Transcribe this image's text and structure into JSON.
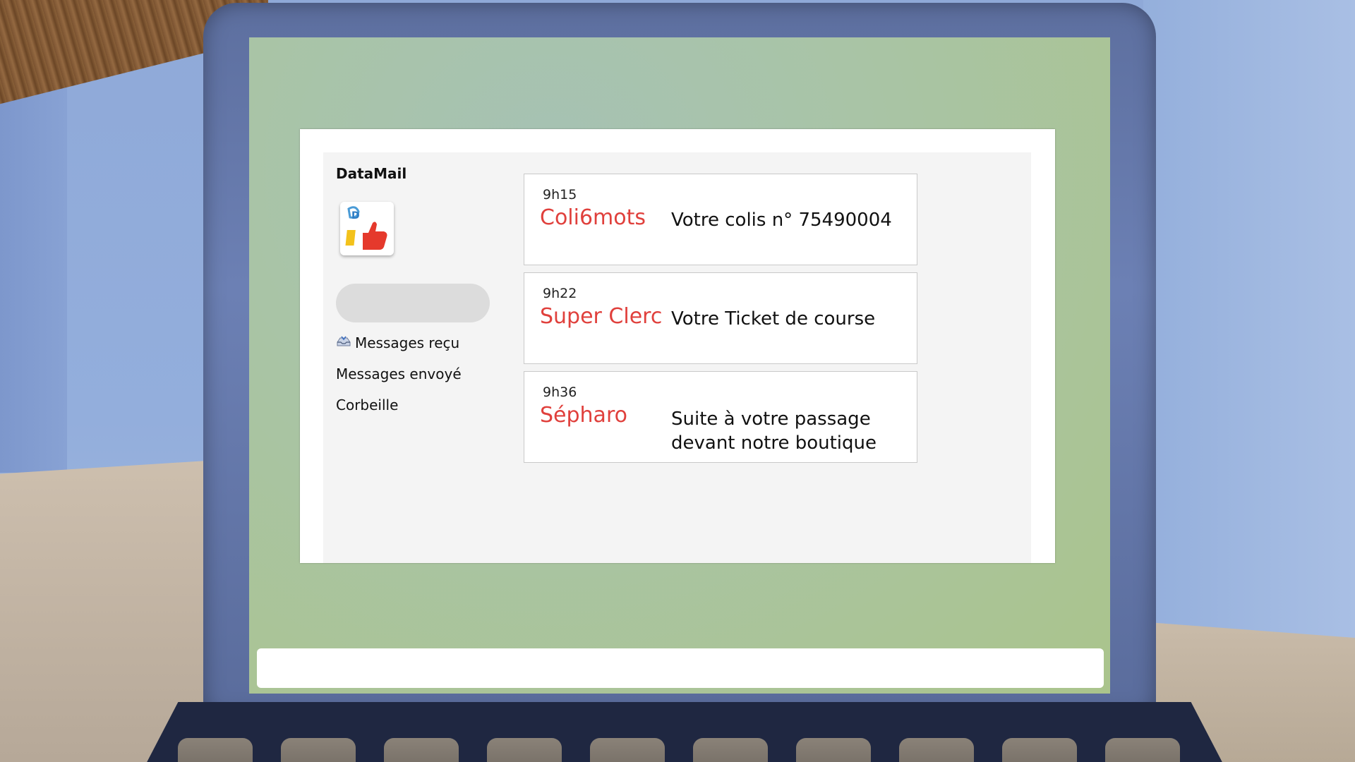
{
  "app": {
    "name": "DataMail",
    "logo_icon": "thumbs-up-logo-icon"
  },
  "sidebar": {
    "search_placeholder": "",
    "nav": [
      {
        "label": "Messages reçu",
        "icon": "inbox-tray-icon"
      },
      {
        "label": "Messages envoyé"
      },
      {
        "label": "Corbeille"
      }
    ]
  },
  "messages": [
    {
      "time": "9h15",
      "sender": "Coli6mots",
      "subject": "Votre colis n° 75490004"
    },
    {
      "time": "9h22",
      "sender": "Super Clerc",
      "subject": "Votre Ticket de course"
    },
    {
      "time": "9h36",
      "sender": "Sépharo",
      "subject": "Suite à votre passage devant notre boutique"
    }
  ],
  "colors": {
    "sender": "#e0403c",
    "app_background": "#f4f4f4",
    "monitor_frame": "#6c80b4"
  }
}
